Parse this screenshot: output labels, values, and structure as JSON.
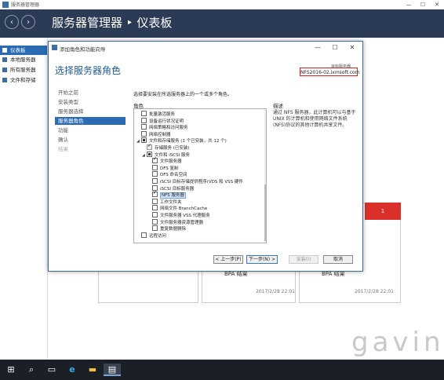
{
  "outer_window": {
    "title": "服务器管理器",
    "header_title": "服务器管理器 ‣ 仪表板",
    "controls": [
      "—",
      "☐",
      "✕"
    ]
  },
  "sidebar": {
    "items": [
      {
        "label": "仪表板",
        "active": true
      },
      {
        "label": "本地服务器"
      },
      {
        "label": "所有服务器"
      },
      {
        "label": "文件和存储"
      }
    ]
  },
  "background_cards": [
    {
      "bpa": "BPA 结果",
      "date": "2017/2/28 22:01"
    },
    {
      "bpa": "BPA 结果",
      "date": "2017/2/28 22:01"
    }
  ],
  "red_card_count": "1",
  "watermark": "gavin",
  "dialog": {
    "title": "添加角色和功能向导",
    "controls": [
      "—",
      "☐",
      "✕"
    ],
    "page_title": "选择服务器角色",
    "server_label": "目标服务器",
    "server_name": "NFS2016-02.ixmsoft.com",
    "instruction": "选择要安装在所选服务器上的一个或多个角色。",
    "roles_header": "角色",
    "desc_header": "描述",
    "description": "通过 NFS 服务器，此计算机可以与基于 UNIX 的计算机和使用网络文件系统(NFS)协议的其他计算机共享文件。",
    "steps": [
      {
        "label": "开始之前",
        "state": "normal"
      },
      {
        "label": "安装类型",
        "state": "normal"
      },
      {
        "label": "服务器选择",
        "state": "normal"
      },
      {
        "label": "服务器角色",
        "state": "active"
      },
      {
        "label": "功能",
        "state": "normal"
      },
      {
        "label": "确认",
        "state": "normal"
      },
      {
        "label": "结果",
        "state": "disabled"
      }
    ],
    "roles": [
      {
        "label": "批量激活服务",
        "indent": 0,
        "check": "none",
        "exp": ""
      },
      {
        "label": "设备运行状况证明",
        "indent": 0,
        "check": "none",
        "exp": ""
      },
      {
        "label": "网络策略和访问服务",
        "indent": 0,
        "check": "none",
        "exp": ""
      },
      {
        "label": "网络控制器",
        "indent": 0,
        "check": "none",
        "exp": ""
      },
      {
        "label": "文件和存储服务 (1 个已安装，共 12 个)",
        "indent": 0,
        "check": "partial",
        "exp": "◢"
      },
      {
        "label": "存储服务 (已安装)",
        "indent": 1,
        "check": "grayed",
        "exp": ""
      },
      {
        "label": "文件和 iSCSI 服务",
        "indent": 1,
        "check": "partial",
        "exp": "◢"
      },
      {
        "label": "文件服务器",
        "indent": 2,
        "check": "checked",
        "exp": ""
      },
      {
        "label": "DFS 复制",
        "indent": 2,
        "check": "none",
        "exp": ""
      },
      {
        "label": "DFS 命名空间",
        "indent": 2,
        "check": "none",
        "exp": ""
      },
      {
        "label": "iSCSI 目标存储提供程序(VDS 和 VSS 硬件",
        "indent": 2,
        "check": "none",
        "exp": ""
      },
      {
        "label": "iSCSI 目标服务器",
        "indent": 2,
        "check": "none",
        "exp": ""
      },
      {
        "label": "NFS 服务器",
        "indent": 2,
        "check": "checked",
        "exp": "",
        "selected": true
      },
      {
        "label": "工作文件夹",
        "indent": 2,
        "check": "none",
        "exp": ""
      },
      {
        "label": "网络文件 BranchCache",
        "indent": 2,
        "check": "none",
        "exp": ""
      },
      {
        "label": "文件服务器 VSS 代理服务",
        "indent": 2,
        "check": "none",
        "exp": ""
      },
      {
        "label": "文件服务器资源管理器",
        "indent": 2,
        "check": "none",
        "exp": ""
      },
      {
        "label": "重复数据删除",
        "indent": 2,
        "check": "none",
        "exp": ""
      },
      {
        "label": "远程访问",
        "indent": 0,
        "check": "none",
        "exp": ""
      }
    ],
    "buttons": {
      "prev": "< 上一步(P)",
      "next": "下一步(N) >",
      "install": "安装(I)",
      "cancel": "取消"
    }
  },
  "taskbar": {
    "icons": [
      "start-icon",
      "search-icon",
      "task-view-icon",
      "ie-icon",
      "explorer-icon",
      "server-manager-icon"
    ]
  },
  "colors": {
    "header_bg": "#2b3a55",
    "accent": "#2a6cb4",
    "red_highlight": "#e32020"
  }
}
